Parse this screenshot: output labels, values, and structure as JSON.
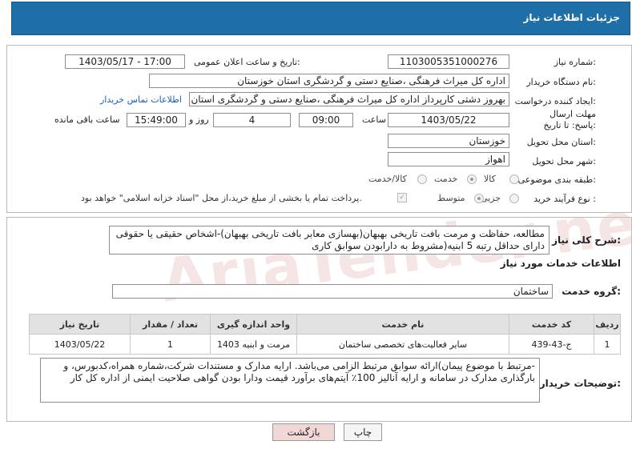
{
  "header": {
    "title": "جزئیات اطلاعات نیاز"
  },
  "form": {
    "need_number_label": "شماره نیاز:",
    "need_number": "1103005351000276",
    "announce_label": "تاریخ و ساعت اعلان عمومی:",
    "announce_value": "1403/05/17 - 17:00",
    "buyer_org_label": "نام دستگاه خریدار:",
    "buyer_org": "اداره کل میراث فرهنگی ،صنایع دستی و گردشگری استان خوزستان",
    "requester_label": "ایجاد کننده درخواست:",
    "requester": "بهروز دشتی کارپرداز اداره کل میراث فرهنگی ،صنایع دستی و گردشگری استان خوزستان",
    "contact_link": "اطلاعات تماس خریدار",
    "deadline_label": "مهلت ارسال پاسخ: تا تاریخ:",
    "deadline_date": "1403/05/22",
    "time_label": "ساعت",
    "deadline_time": "09:00",
    "days_value": "4",
    "days_label": "روز و",
    "remaining_time": "15:49:00",
    "remaining_label": "ساعت باقی مانده",
    "province_label": "استان محل تحویل:",
    "province": "خوزستان",
    "city_label": "شهر محل تحویل:",
    "city": "اهواز",
    "category_label": "طبقه بندی موضوعی:",
    "category_options": [
      "کالا",
      "خدمت",
      "کالا/خدمت"
    ],
    "purchase_type_label": "نوع فرآیند خرید :",
    "purchase_options": [
      "جزیی",
      "متوسط"
    ],
    "payment_note": "پرداخت تمام یا بخشی از مبلغ خرید،از محل \"اسناد خزانه اسلامی\" خواهد بود."
  },
  "summary": {
    "label": "شرح کلی نیاز:",
    "text": "مطالعه، حفاظت و مرمت بافت تاریخی بهبهان(بهسازی معابر بافت تاریخی بهبهان)-اشخاص حقیقی یا حقوقی دارای حداقل رتبه 5 ابنیه(مشروط به دارابودن سوابق کاری",
    "services_heading": "اطلاعات خدمات مورد نیاز",
    "group_label": "گروه خدمت:",
    "group_value": "ساختمان"
  },
  "table": {
    "headers": [
      "ردیف",
      "کد خدمت",
      "نام خدمت",
      "واحد اندازه گیری",
      "تعداد / مقدار",
      "تاریخ نیاز"
    ],
    "rows": [
      [
        "1",
        "ج-43-439",
        "سایر فعالیت‌های تخصصی ساختمان",
        "مرمت و ابنیه 1403",
        "1",
        "1403/05/22"
      ]
    ]
  },
  "buyer_notes": {
    "label": "توضیحات خریدار:",
    "text": "-مرتبط با موضوع پیمان)ارائه سوابق مرتبط الزامی می‌باشد. ارایه مدارک و مستندات شرکت،شماره همراه،کدبورس، و بارگذاری مدارک در سامانه و ارایه آنالیز 100٪ آیتم‌های برآورد قیمت ودارا بودن گواهی صلاحیت ایمنی از اداره کل کار"
  },
  "buttons": {
    "print": "چاپ",
    "back": "بازگشت"
  },
  "watermark": "AriaTender.net"
}
